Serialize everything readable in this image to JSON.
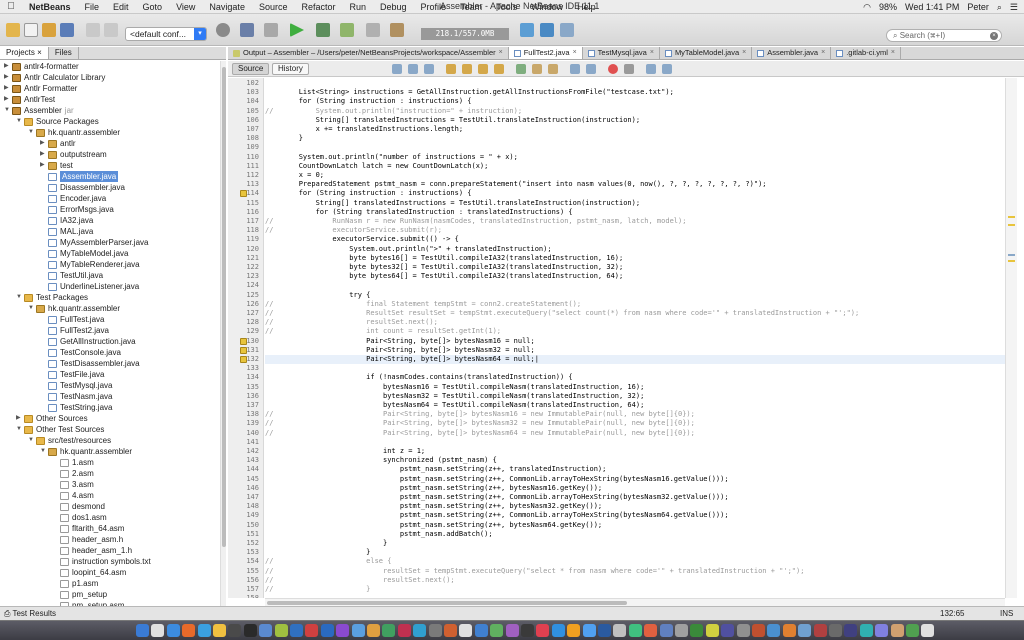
{
  "menubar": {
    "app": "NetBeans",
    "items": [
      "File",
      "Edit",
      "Goto",
      "View",
      "Navigate",
      "Source",
      "Refactor",
      "Run",
      "Debug",
      "Profile",
      "Team",
      "Tools",
      "Window",
      "Help"
    ],
    "window_title": "Assembler - Apache NetBeans IDE 11.1",
    "battery": "98%",
    "clock": "Wed 1:41 PM",
    "user": "Peter"
  },
  "toolbar": {
    "config_value": "<default conf...",
    "memory": "218.1/557.0MB",
    "search_placeholder": "Search (⌘+I)"
  },
  "left_tabs": [
    "Projects",
    "Files"
  ],
  "tree": [
    {
      "d": 0,
      "t": "c",
      "i": "proj",
      "l": "antlr4-formatter"
    },
    {
      "d": 0,
      "t": "c",
      "i": "proj",
      "l": "Antlr Calculator Library"
    },
    {
      "d": 0,
      "t": "c",
      "i": "proj",
      "l": "Antlr Formatter"
    },
    {
      "d": 0,
      "t": "c",
      "i": "proj",
      "l": "AntlrTest"
    },
    {
      "d": 0,
      "t": "o",
      "i": "proj",
      "l": "Assembler",
      "x": "jar"
    },
    {
      "d": 1,
      "t": "o",
      "i": "folder",
      "l": "Source Packages"
    },
    {
      "d": 2,
      "t": "o",
      "i": "pkg",
      "l": "hk.quantr.assembler"
    },
    {
      "d": 3,
      "t": "c",
      "i": "pkg",
      "l": "antlr"
    },
    {
      "d": 3,
      "t": "c",
      "i": "pkg",
      "l": "outputstream"
    },
    {
      "d": 3,
      "t": "c",
      "i": "pkg",
      "l": "test"
    },
    {
      "d": 3,
      "t": "n",
      "i": "java",
      "l": "Assembler.java",
      "sel": true
    },
    {
      "d": 3,
      "t": "n",
      "i": "java",
      "l": "Disassembler.java"
    },
    {
      "d": 3,
      "t": "n",
      "i": "java",
      "l": "Encoder.java"
    },
    {
      "d": 3,
      "t": "n",
      "i": "java",
      "l": "ErrorMsgs.java"
    },
    {
      "d": 3,
      "t": "n",
      "i": "java",
      "l": "IA32.java"
    },
    {
      "d": 3,
      "t": "n",
      "i": "java",
      "l": "MAL.java"
    },
    {
      "d": 3,
      "t": "n",
      "i": "java",
      "l": "MyAssemblerParser.java"
    },
    {
      "d": 3,
      "t": "n",
      "i": "java",
      "l": "MyTableModel.java"
    },
    {
      "d": 3,
      "t": "n",
      "i": "java",
      "l": "MyTableRenderer.java"
    },
    {
      "d": 3,
      "t": "n",
      "i": "java",
      "l": "TestUtil.java"
    },
    {
      "d": 3,
      "t": "n",
      "i": "java",
      "l": "UnderlineListener.java"
    },
    {
      "d": 1,
      "t": "o",
      "i": "folder",
      "l": "Test Packages"
    },
    {
      "d": 2,
      "t": "o",
      "i": "pkg",
      "l": "hk.quantr.assembler"
    },
    {
      "d": 3,
      "t": "n",
      "i": "java",
      "l": "FullTest.java"
    },
    {
      "d": 3,
      "t": "n",
      "i": "java",
      "l": "FullTest2.java"
    },
    {
      "d": 3,
      "t": "n",
      "i": "java",
      "l": "GetAllInstruction.java"
    },
    {
      "d": 3,
      "t": "n",
      "i": "java",
      "l": "TestConsole.java"
    },
    {
      "d": 3,
      "t": "n",
      "i": "java",
      "l": "TestDisassembler.java"
    },
    {
      "d": 3,
      "t": "n",
      "i": "java",
      "l": "TestFile.java"
    },
    {
      "d": 3,
      "t": "n",
      "i": "java",
      "l": "TestMysql.java"
    },
    {
      "d": 3,
      "t": "n",
      "i": "java",
      "l": "TestNasm.java"
    },
    {
      "d": 3,
      "t": "n",
      "i": "java",
      "l": "TestString.java"
    },
    {
      "d": 1,
      "t": "c",
      "i": "folder",
      "l": "Other Sources"
    },
    {
      "d": 1,
      "t": "o",
      "i": "folder",
      "l": "Other Test Sources"
    },
    {
      "d": 2,
      "t": "o",
      "i": "folder",
      "l": "src/test/resources"
    },
    {
      "d": 3,
      "t": "o",
      "i": "pkg",
      "l": "hk.quantr.assembler"
    },
    {
      "d": 4,
      "t": "n",
      "i": "file",
      "l": "1.asm"
    },
    {
      "d": 4,
      "t": "n",
      "i": "file",
      "l": "2.asm"
    },
    {
      "d": 4,
      "t": "n",
      "i": "file",
      "l": "3.asm"
    },
    {
      "d": 4,
      "t": "n",
      "i": "file",
      "l": "4.asm"
    },
    {
      "d": 4,
      "t": "n",
      "i": "file",
      "l": "desmond"
    },
    {
      "d": 4,
      "t": "n",
      "i": "file",
      "l": "dos1.asm"
    },
    {
      "d": 4,
      "t": "n",
      "i": "file",
      "l": "fltarith_64.asm"
    },
    {
      "d": 4,
      "t": "n",
      "i": "file",
      "l": "header_asm.h"
    },
    {
      "d": 4,
      "t": "n",
      "i": "file",
      "l": "header_asm_1.h"
    },
    {
      "d": 4,
      "t": "n",
      "i": "file",
      "l": "instruction symbols.txt"
    },
    {
      "d": 4,
      "t": "n",
      "i": "file",
      "l": "loopint_64.asm"
    },
    {
      "d": 4,
      "t": "n",
      "i": "file",
      "l": "p1.asm"
    },
    {
      "d": 4,
      "t": "n",
      "i": "file",
      "l": "pm_setup"
    },
    {
      "d": 4,
      "t": "n",
      "i": "file",
      "l": "pm_setup.asm"
    }
  ],
  "editor_tabs": [
    {
      "label": "Output – Assembler – /Users/peter/NetBeansProjects/workspace/Assembler",
      "kind": "console"
    },
    {
      "label": "FullTest2.java",
      "kind": "java",
      "active": true
    },
    {
      "label": "TestMysql.java",
      "kind": "java"
    },
    {
      "label": "MyTableModel.java",
      "kind": "java"
    },
    {
      "label": "Assembler.java",
      "kind": "java"
    },
    {
      "label": ".gitlab-ci.yml",
      "kind": "file"
    }
  ],
  "editor_toolbar": {
    "source": "Source",
    "history": "History"
  },
  "code_lines": [
    {
      "n": "102",
      "t": ""
    },
    {
      "n": "103",
      "t": "        List<String> instructions = GetAllInstruction.getAllInstructionsFromFile(\"testcase.txt\");"
    },
    {
      "n": "104",
      "t": "        for (String instruction : instructions) {"
    },
    {
      "n": "105",
      "t": "//          System.out.println(\"instruction=\" + instruction);",
      "cm": true
    },
    {
      "n": "106",
      "t": "            String[] translatedInstructions = TestUtil.translateInstruction(instruction);"
    },
    {
      "n": "107",
      "t": "            x += translatedInstructions.length;"
    },
    {
      "n": "108",
      "t": "        }"
    },
    {
      "n": "109",
      "t": ""
    },
    {
      "n": "110",
      "t": "        System.out.println(\"number of instructions = \" + x);"
    },
    {
      "n": "111",
      "t": "        CountDownLatch latch = new CountDownLatch(x);"
    },
    {
      "n": "112",
      "t": "        x = 0;"
    },
    {
      "n": "113",
      "t": "        PreparedStatement pstmt_nasm = conn.prepareStatement(\"insert into nasm values(0, now(), ?, ?, ?, ?, ?, ?, ?)\");"
    },
    {
      "n": "114",
      "t": "        for (String instruction : instructions) {",
      "w": true
    },
    {
      "n": "115",
      "t": "            String[] translatedInstructions = TestUtil.translateInstruction(instruction);"
    },
    {
      "n": "116",
      "t": "            for (String translatedInstruction : translatedInstructions) {"
    },
    {
      "n": "117",
      "t": "//              RunNasm r = new RunNasm(nasmCodes, translatedInstruction, pstmt_nasm, latch, model);",
      "cm": true
    },
    {
      "n": "118",
      "t": "//              executorService.submit(r);",
      "cm": true
    },
    {
      "n": "119",
      "t": "                executorService.submit(() -> {"
    },
    {
      "n": "120",
      "t": "                    System.out.println(\">\" + translatedInstruction);"
    },
    {
      "n": "121",
      "t": "                    byte bytes16[] = TestUtil.compileIA32(translatedInstruction, 16);"
    },
    {
      "n": "122",
      "t": "                    byte bytes32[] = TestUtil.compileIA32(translatedInstruction, 32);"
    },
    {
      "n": "123",
      "t": "                    byte bytes64[] = TestUtil.compileIA32(translatedInstruction, 64);"
    },
    {
      "n": "124",
      "t": ""
    },
    {
      "n": "125",
      "t": "                    try {"
    },
    {
      "n": "126",
      "t": "//                      final Statement tempStmt = conn2.createStatement();",
      "cm": true
    },
    {
      "n": "127",
      "t": "//                      ResultSet resultSet = tempStmt.executeQuery(\"select count(*) from nasm where code='\" + translatedInstruction + \"';\");",
      "cm": true
    },
    {
      "n": "128",
      "t": "//                      resultSet.next();",
      "cm": true
    },
    {
      "n": "129",
      "t": "//                      int count = resultSet.getInt(1);",
      "cm": true
    },
    {
      "n": "130",
      "t": "                        Pair<String, byte[]> bytesNasm16 = null;",
      "w": true
    },
    {
      "n": "131",
      "t": "                        Pair<String, byte[]> bytesNasm32 = null;",
      "w": true
    },
    {
      "n": "132",
      "t": "                        Pair<String, byte[]> bytesNasm64 = null;|",
      "w": true,
      "cur": true
    },
    {
      "n": "133",
      "t": ""
    },
    {
      "n": "134",
      "t": "                        if (!nasmCodes.contains(translatedInstruction)) {"
    },
    {
      "n": "135",
      "t": "                            bytesNasm16 = TestUtil.compileNasm(translatedInstruction, 16);"
    },
    {
      "n": "136",
      "t": "                            bytesNasm32 = TestUtil.compileNasm(translatedInstruction, 32);"
    },
    {
      "n": "137",
      "t": "                            bytesNasm64 = TestUtil.compileNasm(translatedInstruction, 64);"
    },
    {
      "n": "138",
      "t": "//                          Pair<String, byte[]> bytesNasm16 = new ImmutablePair(null, new byte[]{0});",
      "cm": true
    },
    {
      "n": "139",
      "t": "//                          Pair<String, byte[]> bytesNasm32 = new ImmutablePair(null, new byte[]{0});",
      "cm": true
    },
    {
      "n": "140",
      "t": "//                          Pair<String, byte[]> bytesNasm64 = new ImmutablePair(null, new byte[]{0});",
      "cm": true
    },
    {
      "n": "141",
      "t": ""
    },
    {
      "n": "142",
      "t": "                            int z = 1;"
    },
    {
      "n": "143",
      "t": "                            synchronized (pstmt_nasm) {"
    },
    {
      "n": "144",
      "t": "                                pstmt_nasm.setString(z++, translatedInstruction);"
    },
    {
      "n": "145",
      "t": "                                pstmt_nasm.setString(z++, CommonLib.arrayToHexString(bytesNasm16.getValue()));"
    },
    {
      "n": "146",
      "t": "                                pstmt_nasm.setString(z++, bytesNasm16.getKey());"
    },
    {
      "n": "147",
      "t": "                                pstmt_nasm.setString(z++, CommonLib.arrayToHexString(bytesNasm32.getValue()));"
    },
    {
      "n": "148",
      "t": "                                pstmt_nasm.setString(z++, bytesNasm32.getKey());"
    },
    {
      "n": "149",
      "t": "                                pstmt_nasm.setString(z++, CommonLib.arrayToHexString(bytesNasm64.getValue()));"
    },
    {
      "n": "150",
      "t": "                                pstmt_nasm.setString(z++, bytesNasm64.getKey());"
    },
    {
      "n": "151",
      "t": "                                pstmt_nasm.addBatch();"
    },
    {
      "n": "152",
      "t": "                            }"
    },
    {
      "n": "153",
      "t": "                        }"
    },
    {
      "n": "154",
      "t": "//                      else {",
      "cm": true
    },
    {
      "n": "155",
      "t": "//                          resultSet = tempStmt.executeQuery(\"select * from nasm where code='\" + translatedInstruction + \"';\");",
      "cm": true
    },
    {
      "n": "156",
      "t": "//                          resultSet.next();",
      "cm": true
    },
    {
      "n": "157",
      "t": "//                      }",
      "cm": true
    },
    {
      "n": "158",
      "t": ""
    }
  ],
  "status": {
    "left": "Test Results",
    "position": "132:65",
    "mode": "INS"
  },
  "colors": {
    "selection": "#5b8ed8",
    "accent": "#2f7bf5",
    "warning": "#e8c43c"
  }
}
